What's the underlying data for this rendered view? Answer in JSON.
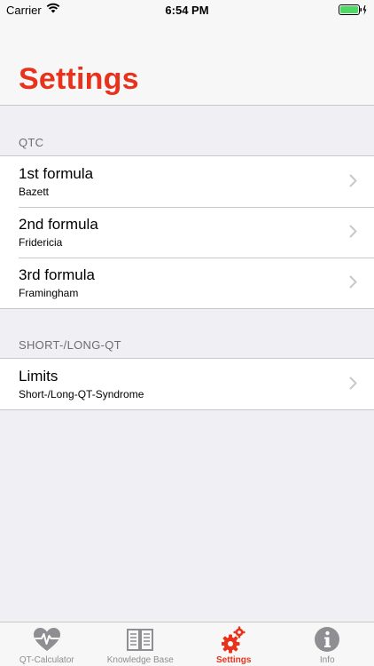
{
  "status_bar": {
    "carrier": "Carrier",
    "time": "6:54 PM"
  },
  "header": {
    "title": "Settings"
  },
  "sections": [
    {
      "header": "QTC",
      "rows": [
        {
          "title": "1st formula",
          "subtitle": "Bazett"
        },
        {
          "title": "2nd formula",
          "subtitle": "Fridericia"
        },
        {
          "title": "3rd formula",
          "subtitle": "Framingham"
        }
      ]
    },
    {
      "header": "SHORT-/LONG-QT",
      "rows": [
        {
          "title": "Limits",
          "subtitle": "Short-/Long-QT-Syndrome"
        }
      ]
    }
  ],
  "tab_bar": {
    "tabs": [
      {
        "label": "QT-Calculator",
        "icon": "heart-pulse-icon",
        "active": false
      },
      {
        "label": "Knowledge Base",
        "icon": "book-icon",
        "active": false
      },
      {
        "label": "Settings",
        "icon": "gears-icon",
        "active": true
      },
      {
        "label": "Info",
        "icon": "info-icon",
        "active": false
      }
    ]
  },
  "colors": {
    "accent": "#e8321c",
    "inactive": "#8e8e93",
    "battery": "#4cd964"
  }
}
